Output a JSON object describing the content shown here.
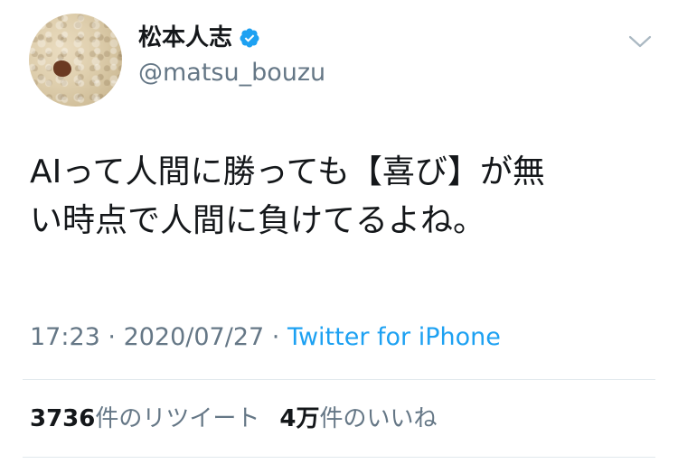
{
  "user": {
    "display_name": "松本人志",
    "handle": "@matsu_bouzu",
    "verified_icon": "verified-badge-icon",
    "avatar_icon": "avatar"
  },
  "menu_icon": "chevron-down-icon",
  "tweet": {
    "lines": [
      "AIって人間に勝っても【喜び】が無",
      "い時点で人間に負けてるよね。"
    ]
  },
  "meta": {
    "time": "17:23",
    "separator1": " · ",
    "date": "2020/07/27",
    "separator2": " · ",
    "source": "Twitter for iPhone"
  },
  "stats": {
    "retweets_count": "3736",
    "retweets_label": "件のリツイート",
    "likes_count": "4万",
    "likes_label": "件のいいね"
  },
  "colors": {
    "text": "#14171a",
    "secondary": "#657786",
    "link": "#1da1f2",
    "divider": "#e1e8ed",
    "verified": "#1da1f2"
  }
}
